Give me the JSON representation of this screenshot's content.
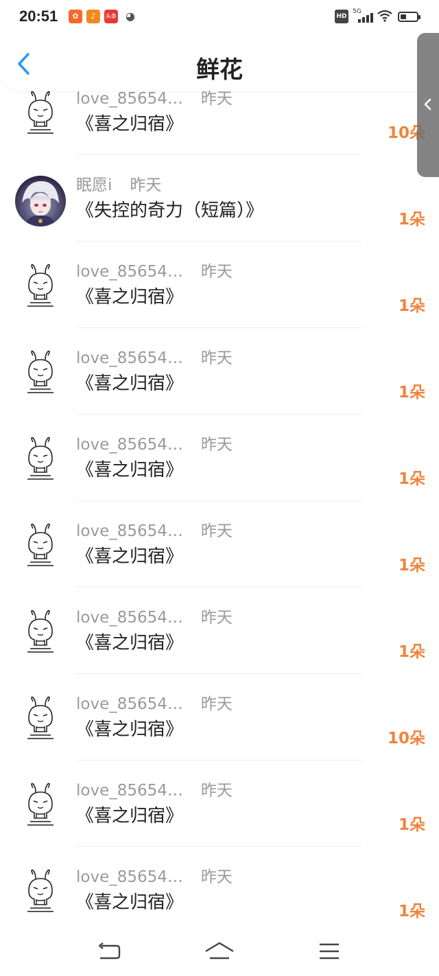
{
  "status_bar": {
    "time": "20:51",
    "notifications": [
      "app-icon-1",
      "douyin-icon",
      "toutiao-icon",
      "wechat-icon"
    ],
    "notif3_text": "头条",
    "hd_label": "HD",
    "network": "5G",
    "wifi_icon": "wifi-icon",
    "battery_icon": "battery-icon"
  },
  "header": {
    "title": "鲜花",
    "back_icon": "chevron-left-icon"
  },
  "colors": {
    "accent_blue": "#2b9af3",
    "count_orange": "#f0843c",
    "meta_gray": "#9a9a9a"
  },
  "rows": [
    {
      "user": "love_85654…",
      "time": "昨天",
      "book": "《喜之归宿》",
      "count": "10朵",
      "avatar": "rabbit-avatar"
    },
    {
      "user": "眠愿i",
      "time": "昨天",
      "book": "《失控的奇力（短篇）》",
      "count": "1朵",
      "avatar": "anime-avatar"
    },
    {
      "user": "love_85654…",
      "time": "昨天",
      "book": "《喜之归宿》",
      "count": "1朵",
      "avatar": "rabbit-avatar"
    },
    {
      "user": "love_85654…",
      "time": "昨天",
      "book": "《喜之归宿》",
      "count": "1朵",
      "avatar": "rabbit-avatar"
    },
    {
      "user": "love_85654…",
      "time": "昨天",
      "book": "《喜之归宿》",
      "count": "1朵",
      "avatar": "rabbit-avatar"
    },
    {
      "user": "love_85654…",
      "time": "昨天",
      "book": "《喜之归宿》",
      "count": "1朵",
      "avatar": "rabbit-avatar"
    },
    {
      "user": "love_85654…",
      "time": "昨天",
      "book": "《喜之归宿》",
      "count": "1朵",
      "avatar": "rabbit-avatar"
    },
    {
      "user": "love_85654…",
      "time": "昨天",
      "book": "《喜之归宿》",
      "count": "10朵",
      "avatar": "rabbit-avatar"
    },
    {
      "user": "love_85654…",
      "time": "昨天",
      "book": "《喜之归宿》",
      "count": "1朵",
      "avatar": "rabbit-avatar"
    },
    {
      "user": "love_85654…",
      "time": "昨天",
      "book": "《喜之归宿》",
      "count": "1朵",
      "avatar": "rabbit-avatar"
    }
  ],
  "side_tab": {
    "icon": "chevron-left-icon"
  },
  "nav_bar": {
    "icons": [
      "back-nav-icon",
      "home-nav-icon",
      "menu-nav-icon"
    ]
  }
}
